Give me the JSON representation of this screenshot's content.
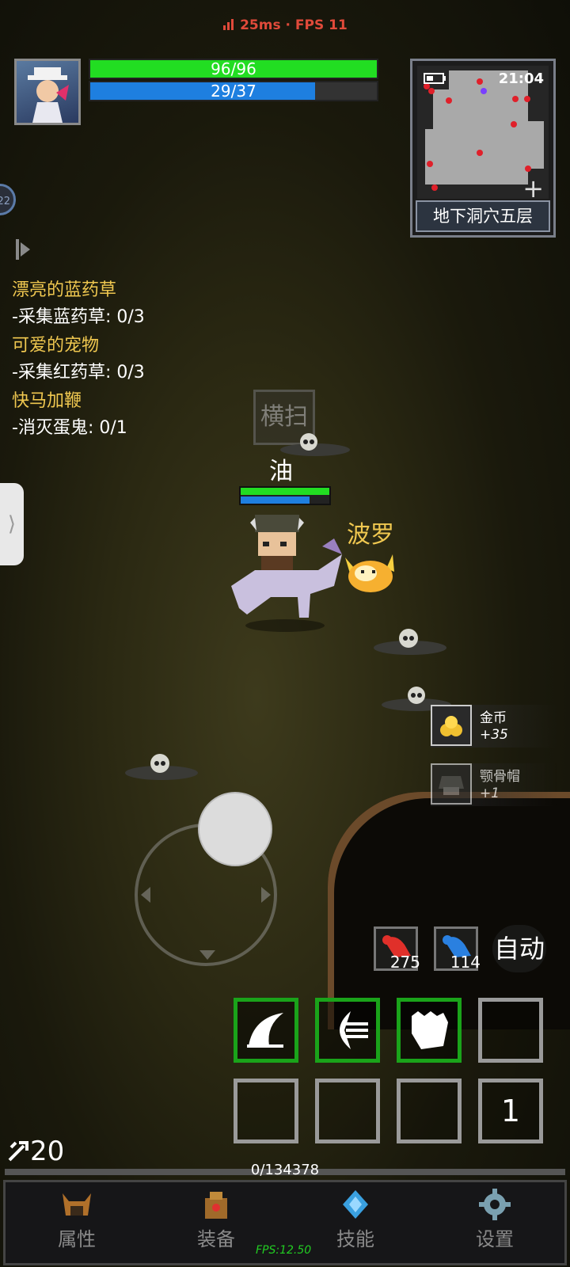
{
  "status": {
    "ping": "25ms",
    "fps": "FPS 11",
    "separator": "·"
  },
  "player": {
    "hp": "96/96",
    "hp_fraction": 1.0,
    "mp": "29/37",
    "mp_fraction": 0.784
  },
  "minimap": {
    "time": "21:04",
    "location": "地下洞穴五层",
    "plus": "+"
  },
  "side_badge": "22",
  "quests": [
    {
      "title": "漂亮的蓝药草",
      "task": "-采集蓝药草: 0/3"
    },
    {
      "title": "可爱的宠物",
      "task": "-采集红药草: 0/3"
    },
    {
      "title": "快马加鞭",
      "task": "-消灭蛋鬼: 0/1"
    }
  ],
  "skill_popup": "横扫",
  "character_name": "油",
  "pet_name": "波罗",
  "loot": [
    {
      "name": "金币",
      "count": "+35"
    },
    {
      "name": "颚骨帽",
      "count": "+1"
    }
  ],
  "potions": {
    "red": "275",
    "blue": "114"
  },
  "auto_label": "自动",
  "slot_number": "1",
  "level": "20",
  "xp": "0/134378",
  "nav": [
    {
      "label": "属性",
      "icon": "helmet-icon"
    },
    {
      "label": "装备",
      "icon": "bag-icon"
    },
    {
      "label": "技能",
      "icon": "crystal-icon"
    },
    {
      "label": "设置",
      "icon": "gear-icon"
    }
  ],
  "fps_small": "FPS:12.50",
  "colors": {
    "hp": "#22dd22",
    "mp": "#1e7fe0",
    "quest_title": "#f0c850",
    "skill_border": "#1aa31a"
  }
}
